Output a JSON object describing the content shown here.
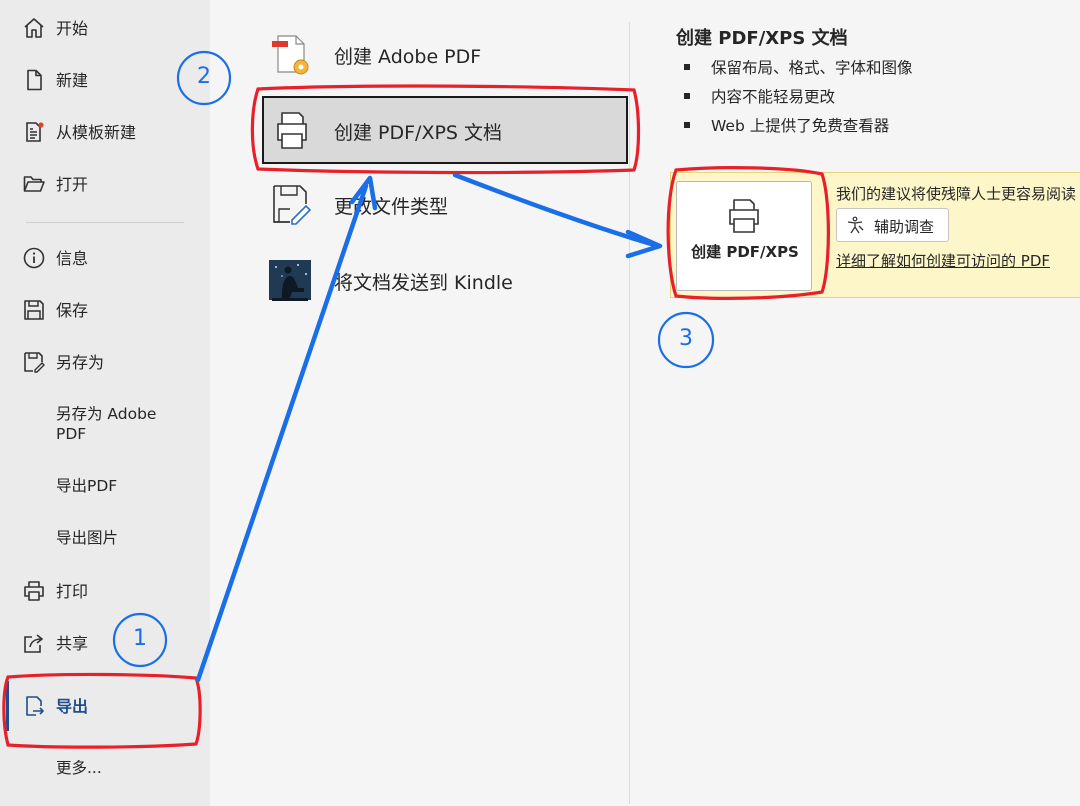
{
  "sidebar": {
    "items": [
      {
        "label": "开始",
        "icon": "home-icon"
      },
      {
        "label": "新建",
        "icon": "new-document-icon"
      },
      {
        "label": "从模板新建",
        "icon": "template-icon"
      },
      {
        "label": "打开",
        "icon": "folder-open-icon"
      },
      {
        "label": "信息",
        "icon": "info-icon"
      },
      {
        "label": "保存",
        "icon": "save-icon"
      },
      {
        "label": "另存为",
        "icon": "save-as-icon"
      },
      {
        "label": "另存为 Adobe\nPDF"
      },
      {
        "label": "导出PDF"
      },
      {
        "label": "导出图片"
      },
      {
        "label": "打印",
        "icon": "print-icon"
      },
      {
        "label": "共享",
        "icon": "share-icon"
      },
      {
        "label": "导出",
        "icon": "export-icon",
        "active": true
      },
      {
        "label": "更多..."
      }
    ]
  },
  "export_options": [
    {
      "label": "创建 Adobe PDF",
      "icon": "adobe-pdf-icon"
    },
    {
      "label": "创建 PDF/XPS 文档",
      "icon": "pdf-xps-icon",
      "selected": true
    },
    {
      "label": "更改文件类型",
      "icon": "change-file-type-icon"
    },
    {
      "label": "将文档发送到 Kindle",
      "icon": "kindle-icon"
    }
  ],
  "detail": {
    "title": "创建 PDF/XPS 文档",
    "bullets": [
      "保留布局、格式、字体和图像",
      "内容不能轻易更改",
      "Web 上提供了免费查看器"
    ],
    "create_button": "创建 PDF/XPS",
    "tip_text": "我们的建议将使残障人士更容易阅读",
    "assist_button": "辅助调查",
    "learn_link": "详细了解如何创建可访问的 PDF"
  },
  "annotations": {
    "step1": "1",
    "step2": "2",
    "step3": "3"
  },
  "colors": {
    "accent_blue": "#1f4e8c",
    "annotation_blue": "#1a6ee8",
    "annotation_red": "#e8202a",
    "tip_background": "#fdf6c9"
  }
}
